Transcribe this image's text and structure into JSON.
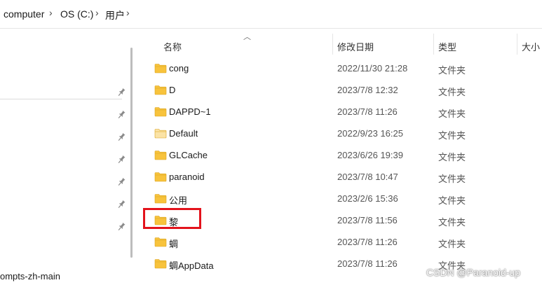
{
  "breadcrumb": {
    "items": [
      "computer",
      "OS (C:)",
      "用户"
    ],
    "separator": "›"
  },
  "nav": {
    "visible_label": "ompts-zh-main",
    "pinned_count": 7
  },
  "columns": {
    "name": "名称",
    "modified": "修改日期",
    "type": "类型",
    "size": "大小"
  },
  "files": [
    {
      "name": "cong",
      "modified": "2022/11/30 21:28",
      "type": "文件夹"
    },
    {
      "name": "D",
      "modified": "2023/7/8 12:32",
      "type": "文件夹"
    },
    {
      "name": "DAPPD~1",
      "modified": "2023/7/8 11:26",
      "type": "文件夹"
    },
    {
      "name": "Default",
      "modified": "2022/9/23 16:25",
      "type": "文件夹",
      "faded": true
    },
    {
      "name": "GLCache",
      "modified": "2023/6/26 19:39",
      "type": "文件夹"
    },
    {
      "name": "paranoid",
      "modified": "2023/7/8 10:47",
      "type": "文件夹"
    },
    {
      "name": "公用",
      "modified": "2023/2/6 15:36",
      "type": "文件夹"
    },
    {
      "name": "黎",
      "modified": "2023/7/8 11:56",
      "type": "文件夹",
      "highlighted": true
    },
    {
      "name": "蜩",
      "modified": "2023/7/8 11:26",
      "type": "文件夹"
    },
    {
      "name": "蜩AppData",
      "modified": "2023/7/8 11:26",
      "type": "文件夹"
    }
  ],
  "watermark": "CSDN @Paranoid-up",
  "colors": {
    "folder": "#f8c33c",
    "folder_faded": "#fbe3a6",
    "highlight": "#e3131c"
  }
}
